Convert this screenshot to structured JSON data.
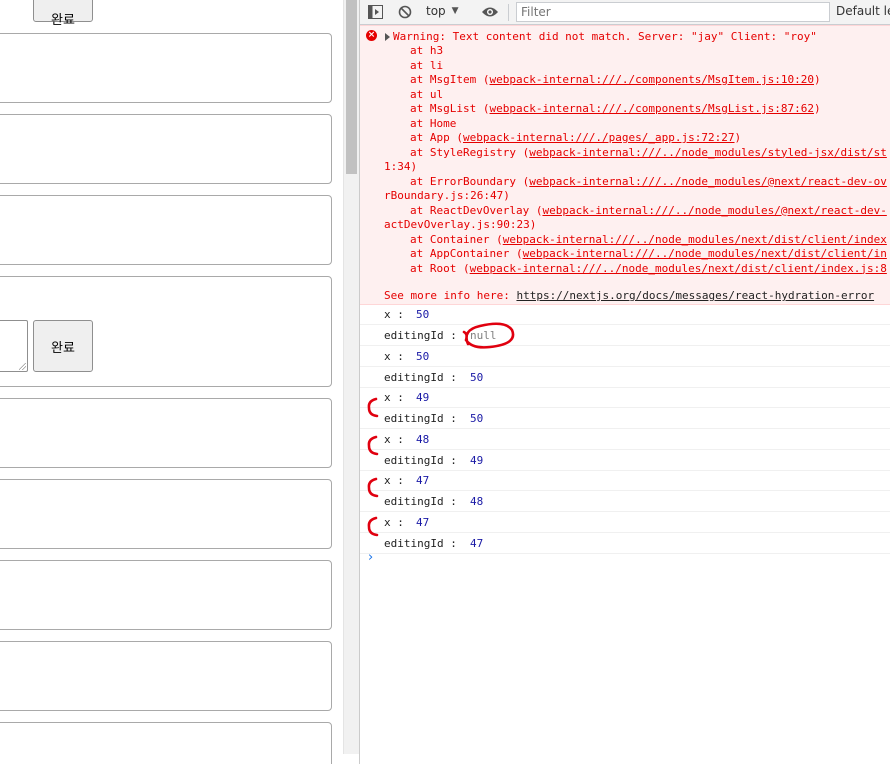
{
  "left_page": {
    "done_label": "완료",
    "done_label_top_partial": "완료"
  },
  "toolbar": {
    "context": "top",
    "filter_placeholder": "Filter",
    "levels_label": "Default le"
  },
  "error": {
    "message": "Warning: Text content did not match. Server: \"jay\" Client: \"roy\"",
    "stack": [
      {
        "at": "at h3"
      },
      {
        "at": "at li"
      },
      {
        "at": "at MsgItem (",
        "link": "webpack-internal:///./components/MsgItem.js:10:20",
        "tail": ")"
      },
      {
        "at": "at ul"
      },
      {
        "at": "at MsgList (",
        "link": "webpack-internal:///./components/MsgList.js:87:62",
        "tail": ")"
      },
      {
        "at": "at Home"
      },
      {
        "at": "at App (",
        "link": "webpack-internal:///./pages/_app.js:72:27",
        "tail": ")"
      },
      {
        "at": "at StyleRegistry (",
        "link": "webpack-internal:///../node_modules/styled-jsx/dist/st",
        "tail": ""
      },
      {
        "wrap": "1:34)"
      },
      {
        "at": "at ErrorBoundary (",
        "link": "webpack-internal:///../node_modules/@next/react-dev-ov",
        "tail": ""
      },
      {
        "wrap": "rBoundary.js:26:47)"
      },
      {
        "at": "at ReactDevOverlay (",
        "link": "webpack-internal:///../node_modules/@next/react-dev-",
        "tail": ""
      },
      {
        "wrap": "actDevOverlay.js:90:23)"
      },
      {
        "at": "at Container (",
        "link": "webpack-internal:///../node_modules/next/dist/client/index",
        "tail": ""
      },
      {
        "at": "at AppContainer (",
        "link": "webpack-internal:///../node_modules/next/dist/client/in",
        "tail": ""
      },
      {
        "at": "at Root (",
        "link": "webpack-internal:///../node_modules/next/dist/client/index.js:8",
        "tail": ""
      }
    ],
    "see_more": "See more info here: ",
    "see_more_link": "https://nextjs.org/docs/messages/react-hydration-error"
  },
  "logs": [
    {
      "label": "x : ",
      "value": "50"
    },
    {
      "label": "editingId : ",
      "value": "null",
      "is_null": true
    },
    {
      "label": "x : ",
      "value": "50"
    },
    {
      "label": "editingId : ",
      "value": "50"
    },
    {
      "label": "x : ",
      "value": "49"
    },
    {
      "label": "editingId : ",
      "value": "50"
    },
    {
      "label": "x : ",
      "value": "48"
    },
    {
      "label": "editingId : ",
      "value": "49"
    },
    {
      "label": "x : ",
      "value": "47"
    },
    {
      "label": "editingId : ",
      "value": "48"
    },
    {
      "label": "x : ",
      "value": "47"
    },
    {
      "label": "editingId : ",
      "value": "47"
    }
  ],
  "prompt_symbol": "›",
  "colors": {
    "error_text": "#e50000",
    "error_bg": "#fef0f0",
    "number_value": "#1a1aa6",
    "annotation": "#e0000f"
  }
}
